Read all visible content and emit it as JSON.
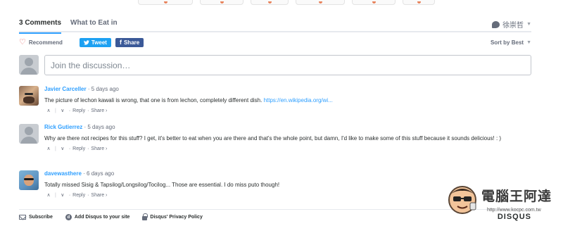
{
  "top_strip": {
    "tab_count": 6,
    "accent": "#e8815a"
  },
  "nav": {
    "tabs": [
      {
        "label": "3 Comments",
        "active": true
      },
      {
        "label": "What to Eat in",
        "active": false
      }
    ],
    "user": {
      "name": "徐崇哲",
      "icon": "speech-bubble-icon"
    }
  },
  "actions": {
    "recommend_label": "Recommend",
    "tweet_label": "Tweet",
    "share_label": "Share",
    "sort_label": "Sort by Best"
  },
  "composer": {
    "placeholder": "Join the discussion…"
  },
  "comments": [
    {
      "author": "Javier Carceller",
      "time": "5 days ago",
      "text": "The picture of lechon kawali is wrong, that one is from lechon, completely different dish.",
      "link": "https://en.wikipedia.org/wi...",
      "reply": "Reply",
      "share": "Share ›"
    },
    {
      "author": "Rick Gutierrez",
      "time": "5 days ago",
      "text": "Why are there not recipes for this stuff? I get, it's better to eat when you are there and that's the whole point, but damn, I'd like to make some of this stuff because it sounds delicious! : )",
      "reply": "Reply",
      "share": "Share ›"
    },
    {
      "author": "davewasthere",
      "time": "6 days ago",
      "text": "Totally missed Sisig & Tapsilog/Longsilog/Tocilog... Those are essential. I do miss puto though!",
      "reply": "Reply",
      "share": "Share ›"
    }
  ],
  "footer": {
    "subscribe": "Subscribe",
    "add_disqus": "Add Disqus to your site",
    "privacy": "Disqus' Privacy Policy",
    "brand": "DISQUS"
  },
  "watermark": {
    "title": "電腦王阿達",
    "url": "http://www.kocpc.com.tw"
  },
  "colors": {
    "accent_blue": "#2e9fff",
    "tweet": "#1da1f2",
    "facebook": "#3b5998",
    "heart": "#e35b5b"
  }
}
